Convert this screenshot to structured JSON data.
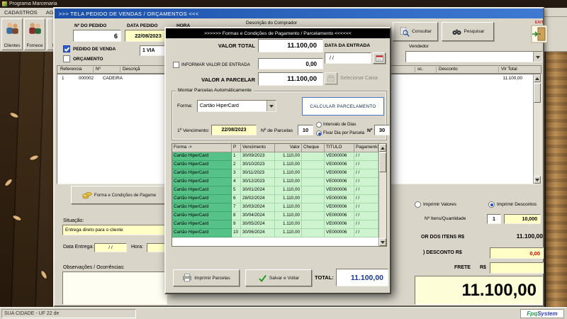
{
  "colors": {
    "titlebar_blue": "#1e4fa8",
    "dialog_titlebar": "#000000",
    "field_yellow": "#ffffc6",
    "row_green": "#cdf4cf",
    "row_green_dark": "#57c287",
    "negative_red": "#cc0000",
    "total_blue": "#1a3a9c"
  },
  "desktop": {
    "program_title": "Programa Marcenaria",
    "menu_items": [
      "CADASTROS",
      "AGENDA"
    ],
    "toolbar_items": [
      "Clientes",
      "Fornece",
      "Func"
    ],
    "status_left": "SUA CIDADE - UF   22 de",
    "logo_part1": "Fpq",
    "logo_part2": "System"
  },
  "order_window": {
    "title": ">>>  TELA PEDIDO DE VENDAS / ORÇAMENTOS   <<<",
    "order_no_label": "Nº DO PEDIDO",
    "order_no": "6",
    "date_label": "DATA PEDIDO",
    "date_value": "22/08/2023",
    "hora_label": "HORA",
    "hora_value": "",
    "buyer_label": "Descrição do Comprador",
    "buyer_value": "",
    "consultar_label": "Consultar",
    "pesquisar_label": "Pesquisar",
    "exit_label": "EXIT",
    "pedido_venda_label": "PEDIDO DE VENDA",
    "orcamento_label": "ORÇAMENTO",
    "via_value": "1 VIA",
    "vendedor_label": "Vendedor",
    "vendedor_value": "",
    "grid_headers": [
      "Referencia",
      "Nº",
      "Descriçã",
      "sc.",
      "Desconto",
      "Vlr Total"
    ],
    "grid_row": {
      "referencia": "1",
      "numero": "000002",
      "descricao": "CADEIRA",
      "vlr_total": "11.100,00"
    },
    "payment_button_label": "Forma e Condições de Pagame",
    "situacao_label": "Situação:",
    "situacao_value": "Entrega direto para o cliente",
    "data_entrega_label": "Data Entrega:",
    "data_entrega_value": "/ /",
    "hora2_label": "Hora:",
    "hora2_value": "",
    "observacoes_label": "Observações / Ocorrências:",
    "observacoes_value": "",
    "imprimir_valores_label": "Imprimir Valores",
    "imprimir_descontos_label": "Imprimir Descontos",
    "itens_label": "Nº Itens/Quantidade",
    "itens_value": "1",
    "quantidade_value": "10,000",
    "valor_itens_label": "OR DOS ITENS R$",
    "valor_itens_value": "11.100,00",
    "desconto_label": ") DESCONTO R$",
    "desconto_value": "0,00",
    "frete_label": "FRETE",
    "moeda_label": "R$",
    "frete_value": "",
    "total_geral": "11.100,00"
  },
  "payment_dialog": {
    "title": ">>>>>>  Formas e Condições de Pagamento / Parcelamento  <<<<<<",
    "valor_total_label": "VALOR TOTAL",
    "valor_total": "11.100,00",
    "informar_entrada_label": "INFORMAR VALOR DE ENTRADA",
    "entrada_value": "0,00",
    "valor_parcelar_label": "VALOR A PARCELAR",
    "valor_parcelar": "11.100,00",
    "data_entrada_label": "DATA DA ENTRADA",
    "data_entrada_value": "/ /",
    "selecionar_caixa_label": "Selecionar Caixa",
    "group_label": "Montar Parcelas Automáticamente",
    "forma_label": "Forma:",
    "forma_value": "Cartão HiperCard",
    "calcular_label": "CALCULAR  PARCELAMENTO",
    "vencimento_label": "1º Vencimento:",
    "vencimento_value": "22/08/2023",
    "parcelas_label": "Nº de Parcelas",
    "parcelas_value": "10",
    "intervalo_label": "Intervalo de Dias",
    "fixar_label": "Fixar Dia por Parcela",
    "num_label": "Nº",
    "num_value": "30",
    "table": {
      "headers": [
        "Forma ->",
        "P",
        "Vencimento",
        "Valor",
        "Cheque",
        "TITULO",
        "Pagamento <"
      ],
      "rows": [
        {
          "forma": "Cartão HiperCard",
          "p": "1",
          "vencimento": "30/09/2023",
          "valor": "1.110,00",
          "cheque": "",
          "titulo": "VE000006",
          "pagamento": "/ /"
        },
        {
          "forma": "Cartão HiperCard",
          "p": "2",
          "vencimento": "30/10/2023",
          "valor": "1.110,00",
          "cheque": "",
          "titulo": "VE000006",
          "pagamento": "/ /"
        },
        {
          "forma": "Cartão HiperCard",
          "p": "3",
          "vencimento": "30/11/2023",
          "valor": "1.110,00",
          "cheque": "",
          "titulo": "VE000006",
          "pagamento": "/ /"
        },
        {
          "forma": "Cartão HiperCard",
          "p": "4",
          "vencimento": "30/12/2023",
          "valor": "1.110,00",
          "cheque": "",
          "titulo": "VE000006",
          "pagamento": "/ /"
        },
        {
          "forma": "Cartão HiperCard",
          "p": "5",
          "vencimento": "30/01/2024",
          "valor": "1.110,00",
          "cheque": "",
          "titulo": "VE000006",
          "pagamento": "/ /"
        },
        {
          "forma": "Cartão HiperCard",
          "p": "6",
          "vencimento": "28/02/2024",
          "valor": "1.110,00",
          "cheque": "",
          "titulo": "VE000006",
          "pagamento": "/ /"
        },
        {
          "forma": "Cartão HiperCard",
          "p": "7",
          "vencimento": "30/03/2024",
          "valor": "1.110,00",
          "cheque": "",
          "titulo": "VE000006",
          "pagamento": "/ /"
        },
        {
          "forma": "Cartão HiperCard",
          "p": "8",
          "vencimento": "30/04/2024",
          "valor": "1.110,00",
          "cheque": "",
          "titulo": "VE000006",
          "pagamento": "/ /"
        },
        {
          "forma": "Cartão HiperCard",
          "p": "9",
          "vencimento": "30/05/2024",
          "valor": "1.110,00",
          "cheque": "",
          "titulo": "VE000006",
          "pagamento": "/ /"
        },
        {
          "forma": "Cartão HiperCard",
          "p": "10",
          "vencimento": "30/06/2024",
          "valor": "1.110,00",
          "cheque": "",
          "titulo": "VE000006",
          "pagamento": "/ /"
        }
      ]
    },
    "imprimir_parcelas_label": "Imprimir Parcelas",
    "salvar_label": "Salvar e Voltar",
    "total_label": "TOTAL:",
    "total_value": "11.100,00"
  }
}
